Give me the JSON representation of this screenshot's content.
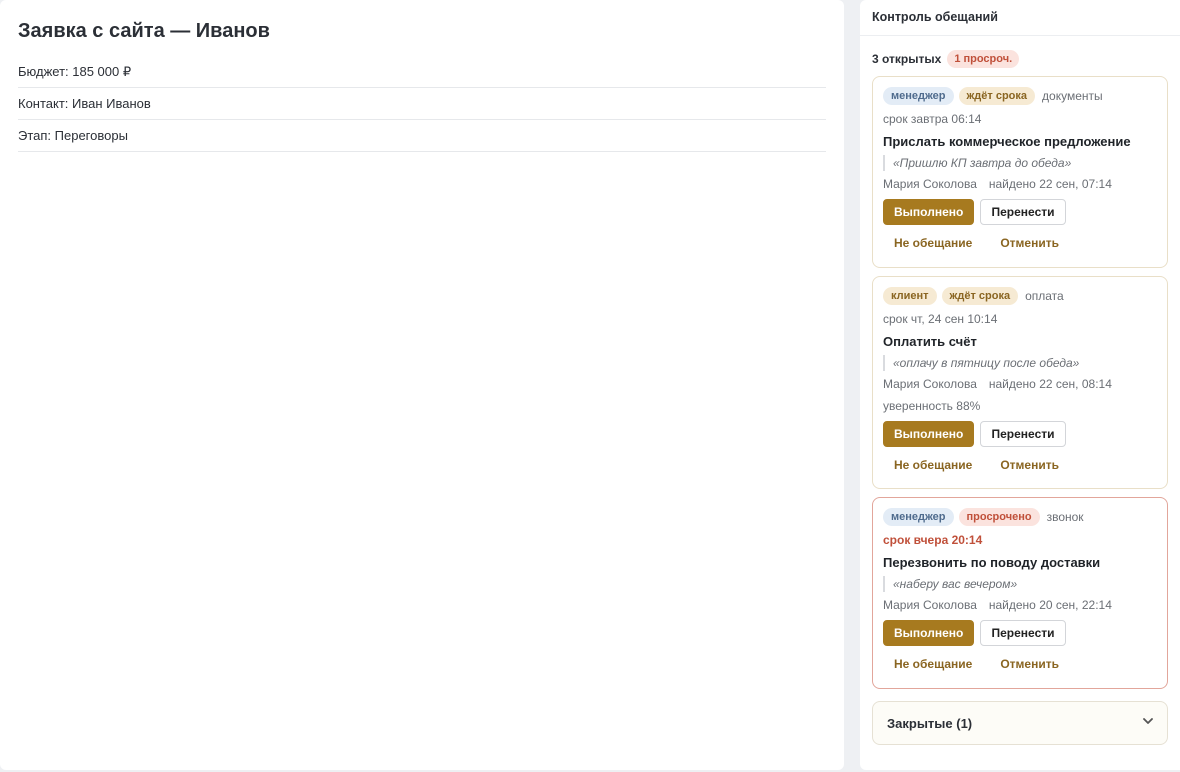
{
  "deal": {
    "title": "Заявка с сайта — Иванов",
    "fields": [
      "Бюджет: 185 000 ₽",
      "Контакт: Иван Иванов",
      "Этап: Переговоры"
    ]
  },
  "panel": {
    "title": "Контроль обещаний",
    "open_count": "3 открытых",
    "overdue_badge": "1 просроч.",
    "cards": [
      {
        "owner": "менеджер",
        "status": "ждёт срока",
        "kind": "документы",
        "due": "срок завтра 06:14",
        "title": "Прислать коммерческое предложение",
        "quote": "«Пришлю КП завтра до обеда»",
        "author": "Мария Соколова",
        "found": "найдено 22 сен, 07:14",
        "done": "Выполнено",
        "move": "Перенести",
        "not_promise": "Не обещание",
        "cancel": "Отменить"
      },
      {
        "owner": "клиент",
        "status": "ждёт срока",
        "kind": "оплата",
        "due": "срок чт, 24 сен 10:14",
        "title": "Оплатить счёт",
        "quote": "«оплачу в пятницу после обеда»",
        "author": "Мария Соколова",
        "found": "найдено 22 сен, 08:14",
        "confidence": "уверенность 88%",
        "done": "Выполнено",
        "move": "Перенести",
        "not_promise": "Не обещание",
        "cancel": "Отменить"
      },
      {
        "owner": "менеджер",
        "status": "просрочено",
        "kind": "звонок",
        "due": "срок вчера 20:14",
        "title": "Перезвонить по поводу доставки",
        "quote": "«наберу вас вечером»",
        "author": "Мария Соколова",
        "found": "найдено 20 сен, 22:14",
        "done": "Выполнено",
        "move": "Перенести",
        "not_promise": "Не обещание",
        "cancel": "Отменить"
      }
    ],
    "closed_label": "Закрытые (1)"
  }
}
